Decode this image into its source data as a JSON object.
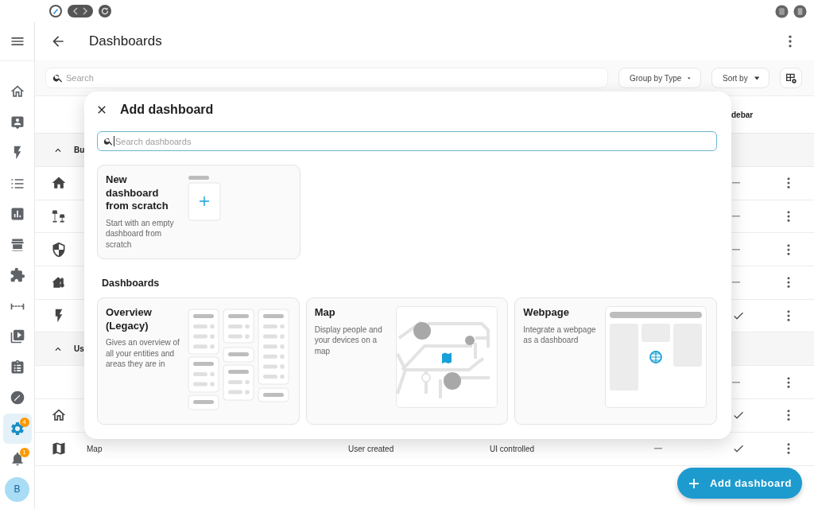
{
  "sidebar": {
    "items": [
      {
        "kind": "house-outline",
        "selected": false
      },
      {
        "kind": "person-card",
        "selected": false
      },
      {
        "kind": "lightning",
        "selected": false
      },
      {
        "kind": "list",
        "selected": false
      },
      {
        "kind": "chart",
        "selected": false
      },
      {
        "kind": "store",
        "selected": false
      },
      {
        "kind": "puzzle",
        "selected": false
      },
      {
        "kind": "bridge",
        "selected": false
      },
      {
        "kind": "media",
        "selected": false
      },
      {
        "kind": "clipboard",
        "selected": false
      },
      {
        "kind": "compass",
        "selected": false
      },
      {
        "kind": "gear",
        "selected": true,
        "badge": "4"
      },
      {
        "kind": "bell",
        "selected": false,
        "badge": "1"
      }
    ],
    "avatar": "B"
  },
  "header": {
    "title": "Dashboards"
  },
  "toolbar": {
    "search": {
      "placeholder": "Search"
    },
    "group_by": "Group by Type",
    "sort_by": "Sort by"
  },
  "table": {
    "header_label": "debar",
    "groups": [
      {
        "label": "Bu",
        "expanded": true,
        "rows": [
          {
            "kind": "house",
            "show_in_sidebar": false
          },
          {
            "kind": "lamp",
            "show_in_sidebar": false
          },
          {
            "kind": "shield",
            "show_in_sidebar": false
          },
          {
            "kind": "house-thermometer",
            "show_in_sidebar": false
          },
          {
            "kind": "lightning",
            "show_in_sidebar": true
          }
        ]
      },
      {
        "label": "Us",
        "expanded": true,
        "rows": [
          {
            "show_in_sidebar": false
          },
          {
            "kind": "house-outline",
            "show_in_sidebar": true
          },
          {
            "kind": "map",
            "title": "Map",
            "type": "User created",
            "mode": "UI controlled",
            "require_admin": false,
            "show_in_sidebar": true
          }
        ]
      }
    ]
  },
  "dialog": {
    "title": "Add dashboard",
    "search": {
      "placeholder": "Search dashboards",
      "focused": true
    },
    "new_card": {
      "kind": "scratch",
      "title": "New dashboard from scratch",
      "description": "Start with an empty dashboard from scratch"
    },
    "section_title": "Dashboards",
    "cards": [
      {
        "kind": "overview",
        "title": "Overview (Legacy)",
        "description": "Gives an overview of all your entities and areas they are in"
      },
      {
        "kind": "map",
        "title": "Map",
        "description": "Display people and your devices on a map"
      },
      {
        "kind": "webpage",
        "title": "Webpage",
        "description": "Integrate a webpage as a dashboard"
      }
    ]
  },
  "fab": {
    "label": "Add dashboard"
  }
}
